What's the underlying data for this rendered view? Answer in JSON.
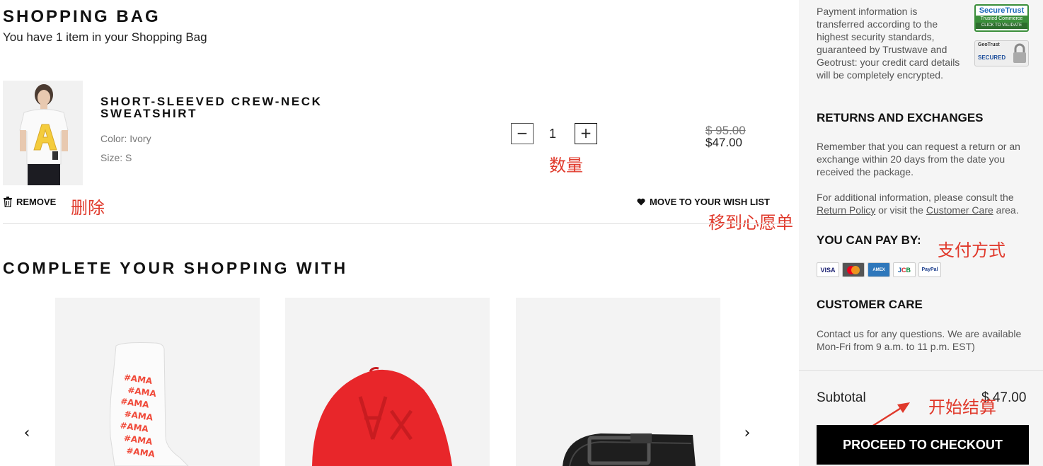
{
  "bag": {
    "title": "SHOPPING BAG",
    "subtitle": "You have 1 item in your Shopping Bag"
  },
  "item": {
    "name": "SHORT-SLEEVED CREW-NECK SWEATSHIRT",
    "color": "Color: Ivory",
    "size": "Size: S",
    "quantity": "1",
    "quantity_minus": "−",
    "quantity_plus": "+",
    "price_original": "$ 95.00",
    "price_sale": "$47.00",
    "remove_label": "REMOVE",
    "wishlist_label": "MOVE TO YOUR WISH LIST"
  },
  "annotations": {
    "quantity": "数量",
    "remove": "删除",
    "wishlist": "移到心愿单",
    "payment": "支付方式",
    "checkout": "开始结算"
  },
  "recommendations": {
    "title": "COMPLETE YOUR SHOPPING WITH",
    "prev_arrow": "‹",
    "next_arrow": "›",
    "sock_text": "#AMA"
  },
  "sidebar": {
    "security_text": "Payment information is transferred according to the highest security standards, guaranteed by Trustwave and Geotrust: your credit card details will be completely encrypted.",
    "securetrust_badge": {
      "line1": "SecureTrust",
      "line2": "Trusted Commerce",
      "line3": "CLICK TO VALIDATE"
    },
    "geotrust_badge": {
      "line1": "GeoTrust",
      "line2": "SECURED"
    },
    "returns_title": "RETURNS AND EXCHANGES",
    "returns_text": "Remember that you can request a return or an exchange within 20 days from the date you received the package.",
    "info_prefix": "For additional information, please consult the",
    "return_policy_link": "Return Policy",
    "info_mid": "or visit the",
    "customer_care_link": "Customer Care",
    "info_suffix": "area.",
    "pay_title": "YOU CAN PAY BY:",
    "pay_methods": [
      "VISA",
      "MC",
      "AMEX",
      "JCB",
      "PayPal"
    ],
    "care_title": "CUSTOMER CARE",
    "care_text": "Contact us for any questions. We are available Mon-Fri from 9 a.m. to 11 p.m. EST)",
    "subtotal_label": "Subtotal",
    "subtotal_value": "$ 47.00",
    "checkout_label": "PROCEED TO CHECKOUT"
  },
  "colors": {
    "annotation": "#e0392b",
    "cap": "#e8262a",
    "sock_print": "#f04a3a",
    "sidebar_bg": "#f5f5f5"
  }
}
